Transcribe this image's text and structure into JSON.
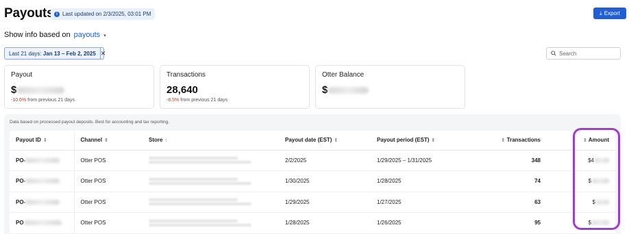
{
  "header": {
    "title": "Payouts",
    "updated_text": "Last updated on 2/3/2025, 03:01 PM",
    "info_icon": "info-icon",
    "export_label": "Export",
    "export_icon": "download-icon"
  },
  "show_info": {
    "label": "Show info based on",
    "value": "payouts"
  },
  "filter": {
    "prefix": "Last 21 days:",
    "range": "Jan 13 – Feb 2, 2025"
  },
  "search": {
    "placeholder": "Search"
  },
  "cards": [
    {
      "label": "Payout",
      "value_prefix": "$",
      "delta": "-10.6%",
      "delta_suffix": "from previous 21 days"
    },
    {
      "label": "Transactions",
      "value": "28,640",
      "delta": "-8.5%",
      "delta_suffix": "from previous 21 days"
    },
    {
      "label": "Otter Balance",
      "value_prefix": "$"
    }
  ],
  "table": {
    "note": "Data based on processed payout deposits. Best for accounting and tax reporting.",
    "columns": {
      "payout_id": "Payout ID",
      "channel": "Channel",
      "store": "Store",
      "payout_date": "Payout date (EST)",
      "payout_period": "Payout period (EST)",
      "transactions": "Transactions",
      "amount": "Amount"
    },
    "rows": [
      {
        "id_prefix": "PO-",
        "channel": "Otter POS",
        "payout_date": "2/2/2025",
        "payout_period": "1/29/2025 – 1/31/2025",
        "transactions": "348",
        "amount_prefix": "$4"
      },
      {
        "id_prefix": "PO-",
        "channel": "Otter POS",
        "payout_date": "1/30/2025",
        "payout_period": "1/28/2025",
        "transactions": "74",
        "amount_prefix": "$"
      },
      {
        "id_prefix": "PO-",
        "channel": "Otter POS",
        "payout_date": "1/29/2025",
        "payout_period": "1/27/2025",
        "transactions": "63",
        "amount_prefix": "$"
      },
      {
        "id_prefix": "PO",
        "channel": "Otter POS",
        "payout_date": "1/28/2025",
        "payout_period": "1/26/2025",
        "transactions": "95",
        "amount_prefix": "$"
      }
    ]
  },
  "colors": {
    "accent": "#1f5fd6",
    "negative": "#d0342c",
    "highlight": "#a736d9"
  }
}
